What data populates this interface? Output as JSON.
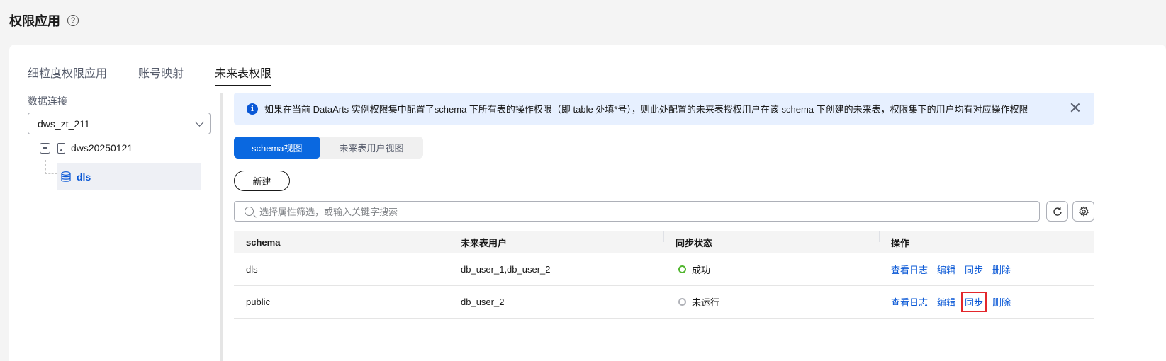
{
  "page": {
    "title": "权限应用",
    "help_icon": "?"
  },
  "tabs": [
    {
      "label": "细粒度权限应用"
    },
    {
      "label": "账号映射"
    },
    {
      "label": "未来表权限"
    }
  ],
  "left_panel": {
    "conn_label": "数据连接",
    "conn_value": "dws_zt_211",
    "tree_root": "dws20250121",
    "tree_child": "dls"
  },
  "info": {
    "icon": "i",
    "text": "如果在当前 DataArts 实例权限集中配置了schema 下所有表的操作权限（即 table 处填*号），则此处配置的未来表授权用户在该 schema 下创建的未来表，权限集下的用户均有对应操作权限"
  },
  "views": {
    "schema": "schema视图",
    "user": "未来表用户视图"
  },
  "new_button": "新建",
  "search": {
    "placeholder": "选择属性筛选，或输入关键字搜索"
  },
  "table": {
    "headers": [
      "schema",
      "未来表用户",
      "同步状态",
      "操作"
    ],
    "rows": [
      {
        "schema": "dls",
        "users": "db_user_1,db_user_2",
        "status": "成功"
      },
      {
        "schema": "public",
        "users": "db_user_2",
        "status": "未运行"
      }
    ],
    "actions": {
      "log": "查看日志",
      "edit": "编辑",
      "sync": "同步",
      "delete": "删除"
    }
  },
  "colors": {
    "accent": "#0a58d6",
    "success": "#50b52d",
    "highlight": "#e3272c"
  }
}
